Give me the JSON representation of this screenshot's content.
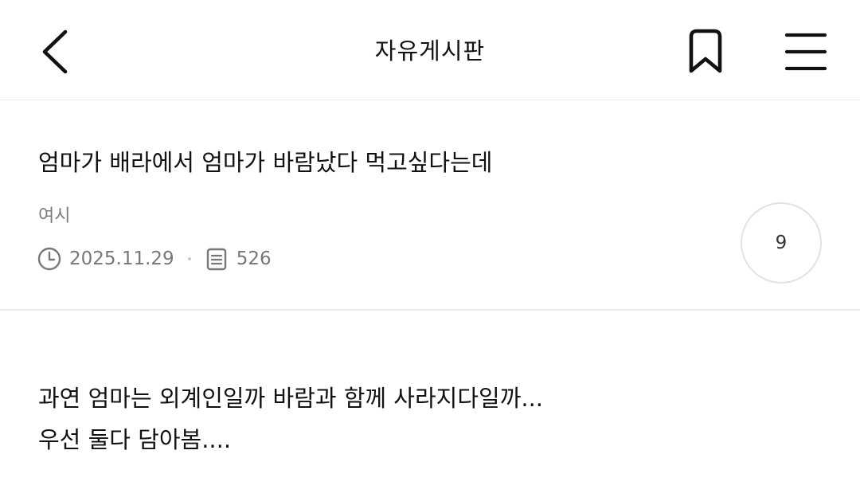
{
  "header": {
    "title": "자유게시판",
    "back_icon": "chevron-left-icon",
    "bookmark_icon": "bookmark-icon",
    "menu_icon": "hamburger-menu-icon"
  },
  "post": {
    "title": "엄마가 배라에서 엄마가 바람났다 먹고싶다는데",
    "author": "여시",
    "date": "2025.11.29",
    "views": "526",
    "comment_count": "9"
  },
  "body": {
    "lines": [
      "과연 엄마는 외계인일까 바람과 함께 사라지다일까...",
      "우선 둘다 담아봄...."
    ]
  }
}
